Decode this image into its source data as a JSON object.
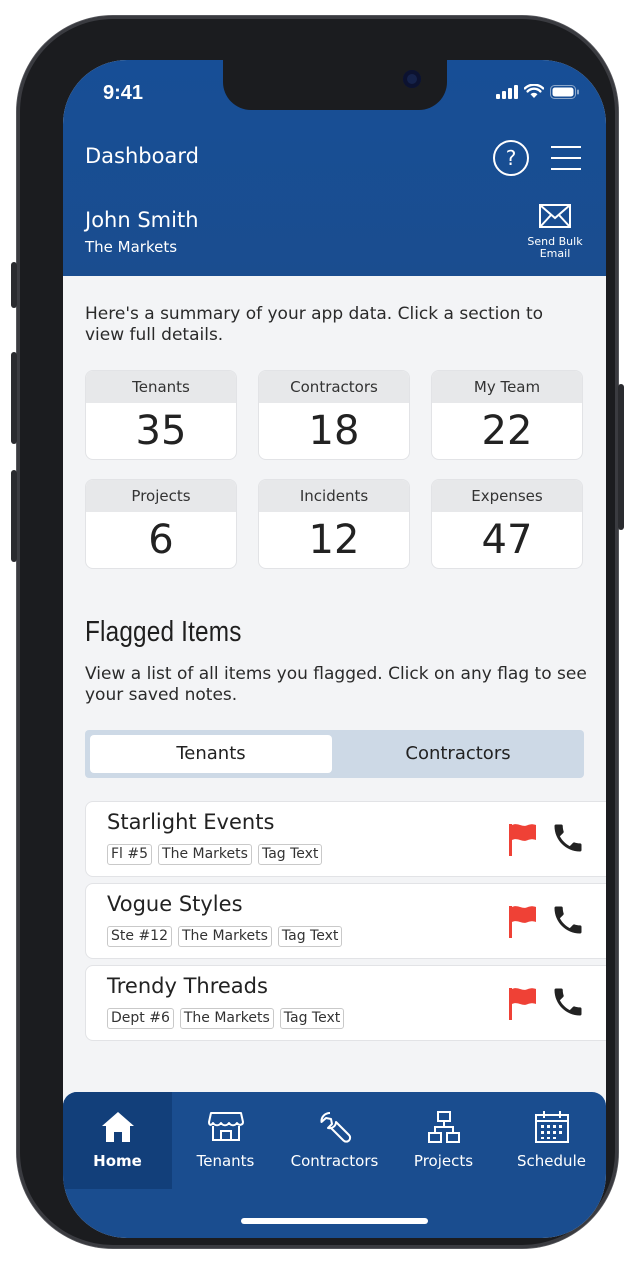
{
  "status_bar": {
    "time": "9:41"
  },
  "header": {
    "title": "Dashboard",
    "help_symbol": "?",
    "user_name": "John Smith",
    "org_name": "The Markets",
    "bulk_email_line1": "Send Bulk",
    "bulk_email_line2": "Email"
  },
  "summary": {
    "intro": "Here's a summary of your app data. Click a section to view full details.",
    "cards": [
      {
        "label": "Tenants",
        "value": "35"
      },
      {
        "label": "Contractors",
        "value": "18"
      },
      {
        "label": "My Team",
        "value": "22"
      },
      {
        "label": "Projects",
        "value": "6"
      },
      {
        "label": "Incidents",
        "value": "12"
      },
      {
        "label": "Expenses",
        "value": "47"
      }
    ]
  },
  "flagged": {
    "title": "Flagged Items",
    "description": "View a list of all items you flagged. Click on any flag to see your saved notes.",
    "tabs": {
      "active": "Tenants",
      "other": "Contractors"
    },
    "items": [
      {
        "name": "Starlight Events",
        "tags": [
          "Fl #5",
          "The Markets",
          "Tag Text"
        ]
      },
      {
        "name": "Vogue Styles",
        "tags": [
          "Ste #12",
          "The Markets",
          "Tag Text"
        ]
      },
      {
        "name": "Trendy Threads",
        "tags": [
          "Dept #6",
          "The Markets",
          "Tag Text"
        ]
      }
    ]
  },
  "tabbar": {
    "items": [
      {
        "label": "Home",
        "icon": "home-icon"
      },
      {
        "label": "Tenants",
        "icon": "storefront-icon"
      },
      {
        "label": "Contractors",
        "icon": "wrench-icon"
      },
      {
        "label": "Projects",
        "icon": "org-chart-icon"
      },
      {
        "label": "Schedule",
        "icon": "calendar-icon"
      }
    ]
  },
  "colors": {
    "header_blue": "#1a4d8f",
    "segment_bg": "#cdd9e6",
    "flag_red": "#ef4136"
  }
}
